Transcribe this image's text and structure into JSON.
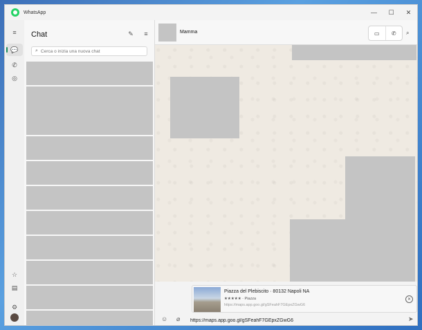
{
  "window": {
    "title": "WhatsApp",
    "controls": {
      "minimize": "—",
      "maximize": "☐",
      "close": "✕"
    }
  },
  "rail": {
    "menu_icon": "≡",
    "chats_icon": "💬",
    "calls_icon": "✆",
    "status_icon": "◎",
    "starred_icon": "☆",
    "archive_icon": "▤",
    "settings_icon": "⚙"
  },
  "chatlist": {
    "title": "Chat",
    "new_chat_icon": "✎",
    "filter_icon": "≡",
    "search": {
      "icon": "⌕",
      "placeholder": "Cerca o inizia una nuova chat"
    }
  },
  "conversation": {
    "contact_name": "Mamma",
    "video_call_icon": "▭",
    "voice_call_icon": "✆",
    "search_icon": "⌕"
  },
  "link_preview": {
    "title": "Piazza del Plebiscito · 80132 Napoli NA",
    "subtitle": "★★★★★ · Piazza",
    "url": "https://maps.app.goo.gl/gSFeahF7GEpxZGwG6",
    "close_icon": "✕"
  },
  "composer": {
    "emoji_icon": "☺",
    "attach_icon": "⌀",
    "value": "https://maps.app.goo.gl/gSFeahF7GEpxZGwG6",
    "send_icon": "➤"
  }
}
